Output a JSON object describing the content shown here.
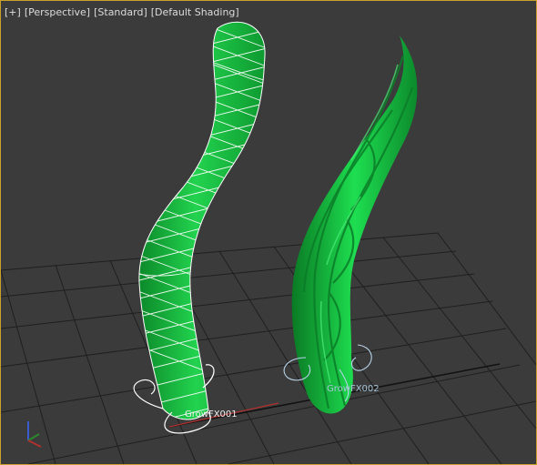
{
  "viewport": {
    "labels": [
      "[+]",
      "[Perspective]",
      "[Standard]",
      "[Default Shading]"
    ],
    "border_color": "#c8a02a",
    "background": "#3b3b3b",
    "grid_color": "#1f1f1f",
    "axis_colors": {
      "x": "#b03030",
      "y": "#2a8a2a",
      "z": "#3a5ad0"
    }
  },
  "objects": [
    {
      "name": "GrowFX001",
      "color": "#1ec84a",
      "display": "wireframe-over-shaded",
      "selected": true
    },
    {
      "name": "GrowFX002",
      "color": "#12d244",
      "display": "shaded",
      "selected": false
    }
  ],
  "axis_gizmo": {
    "labels": [
      "z",
      "y",
      "x"
    ]
  }
}
